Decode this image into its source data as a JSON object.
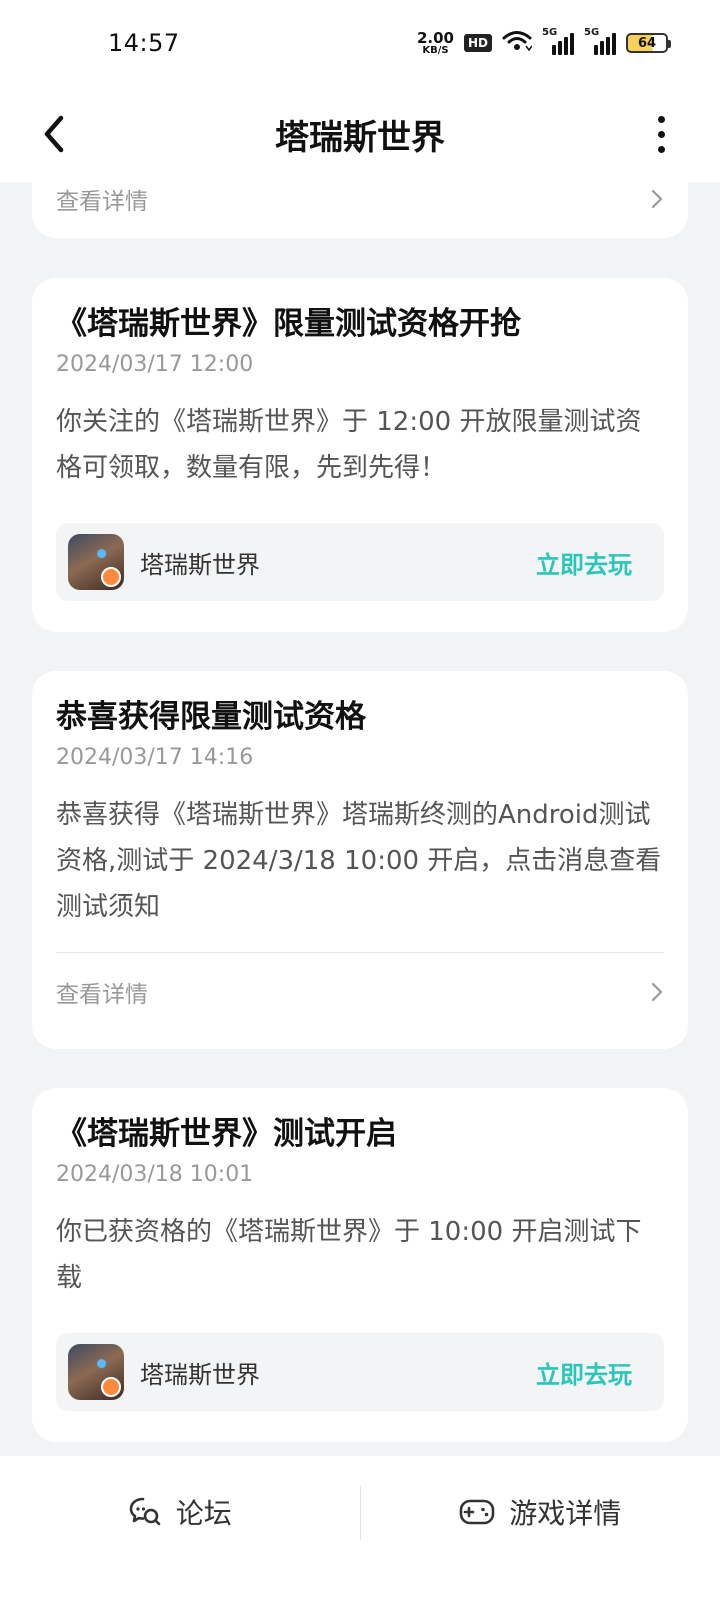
{
  "status_bar": {
    "time": "14:57",
    "net_speed_value": "2.00",
    "net_speed_unit": "KB/S",
    "hd_label": "HD",
    "signal_1_label": "5G",
    "signal_2_label": "5G",
    "battery_level": "64"
  },
  "nav": {
    "title": "塔瑞斯世界",
    "back_icon": "chevron-left-icon",
    "more_icon": "more-vertical-icon"
  },
  "top_partial_card": {
    "details_label": "查看详情"
  },
  "messages": [
    {
      "title": "《塔瑞斯世界》限量测试资格开抢",
      "time": "2024/03/17 12:00",
      "body": "你关注的《塔瑞斯世界》于 12:00 开放限量测试资格可领取，数量有限，先到先得！",
      "game_name": "塔瑞斯世界",
      "action_label": "立即去玩"
    },
    {
      "title": "恭喜获得限量测试资格",
      "time": "2024/03/17 14:16",
      "body": "恭喜获得《塔瑞斯世界》塔瑞斯终测的Android测试资格,测试于 2024/3/18 10:00 开启，点击消息查看测试须知",
      "details_label": "查看详情"
    },
    {
      "title": "《塔瑞斯世界》测试开启",
      "time": "2024/03/18 10:01",
      "body": "你已获资格的《塔瑞斯世界》于 10:00 开启测试下载",
      "game_name": "塔瑞斯世界",
      "action_label": "立即去玩"
    }
  ],
  "bottom_bar": {
    "forum_label": "论坛",
    "game_details_label": "游戏详情"
  },
  "colors": {
    "accent": "#2ac6b8",
    "background": "#f2f3f5",
    "card": "#ffffff"
  }
}
